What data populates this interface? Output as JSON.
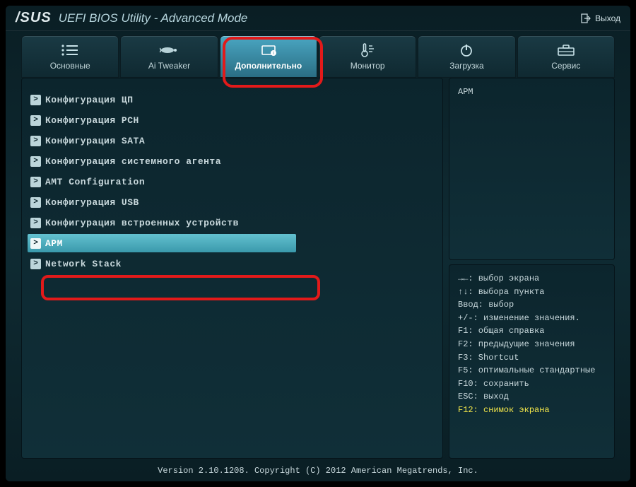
{
  "header": {
    "brand": "/SUS",
    "title": "UEFI BIOS Utility - Advanced Mode",
    "exit_label": "Выход"
  },
  "tabs": [
    {
      "id": "main",
      "label": "Основные",
      "icon": "list-icon"
    },
    {
      "id": "tweaker",
      "label": "Ai Tweaker",
      "icon": "rocket-icon"
    },
    {
      "id": "advanced",
      "label": "Дополнительно",
      "icon": "chip-icon"
    },
    {
      "id": "monitor",
      "label": "Монитор",
      "icon": "thermometer-icon"
    },
    {
      "id": "boot",
      "label": "Загрузка",
      "icon": "power-icon"
    },
    {
      "id": "tool",
      "label": "Сервис",
      "icon": "toolbox-icon"
    }
  ],
  "active_tab": 2,
  "menu": {
    "items": [
      "Конфигурация ЦП",
      "Конфигурация PCH",
      "Конфигурация SATA",
      "Конфигурация системного агента",
      "AMT Configuration",
      "Конфигурация USB",
      "Конфигурация встроенных устройств",
      "APM",
      "Network Stack"
    ],
    "selected_index": 7
  },
  "description": "APM",
  "help_lines": [
    "→←: выбор экрана",
    "↑↓: выбора пункта",
    "Ввод: выбор",
    "+/-: изменение значения.",
    "F1: общая справка",
    "F2: предыдущие значения",
    "F3: Shortcut",
    "F5: оптимальные стандартные",
    "F10: сохранить",
    "ESC: выход"
  ],
  "help_f12": "F12: снимок экрана",
  "footer": "Version 2.10.1208. Copyright (C) 2012 American Megatrends, Inc."
}
